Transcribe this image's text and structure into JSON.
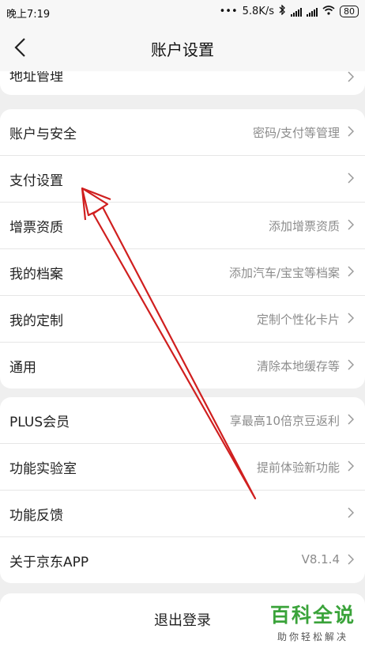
{
  "status_bar": {
    "time": "晚上7:19",
    "network_speed": "5.8K/s",
    "battery": "80",
    "icons": [
      "bluetooth-icon",
      "signal-icon",
      "signal-icon",
      "wifi-icon",
      "battery-icon"
    ]
  },
  "header": {
    "title": "账户设置",
    "back_icon": "chevron-left-icon"
  },
  "partial_row": {
    "label": "地址管理"
  },
  "group1": [
    {
      "label": "账户与安全",
      "value": "密码/支付等管理"
    },
    {
      "label": "支付设置",
      "value": ""
    },
    {
      "label": "增票资质",
      "value": "添加增票资质"
    },
    {
      "label": "我的档案",
      "value": "添加汽车/宝宝等档案"
    },
    {
      "label": "我的定制",
      "value": "定制个性化卡片"
    },
    {
      "label": "通用",
      "value": "清除本地缓存等"
    }
  ],
  "group2": [
    {
      "label": "PLUS会员",
      "value": "享最高10倍京豆返利"
    },
    {
      "label": "功能实验室",
      "value": "提前体验新功能"
    },
    {
      "label": "功能反馈",
      "value": ""
    },
    {
      "label": "关于京东APP",
      "value": "V8.1.4"
    }
  ],
  "logout": {
    "label": "退出登录"
  },
  "watermark": {
    "main": "百科全说",
    "sub": "助你轻松解决"
  },
  "colors": {
    "background": "#efefef",
    "card": "#ffffff",
    "annotation": "#d01f1f",
    "watermark": "#3aa33a"
  }
}
